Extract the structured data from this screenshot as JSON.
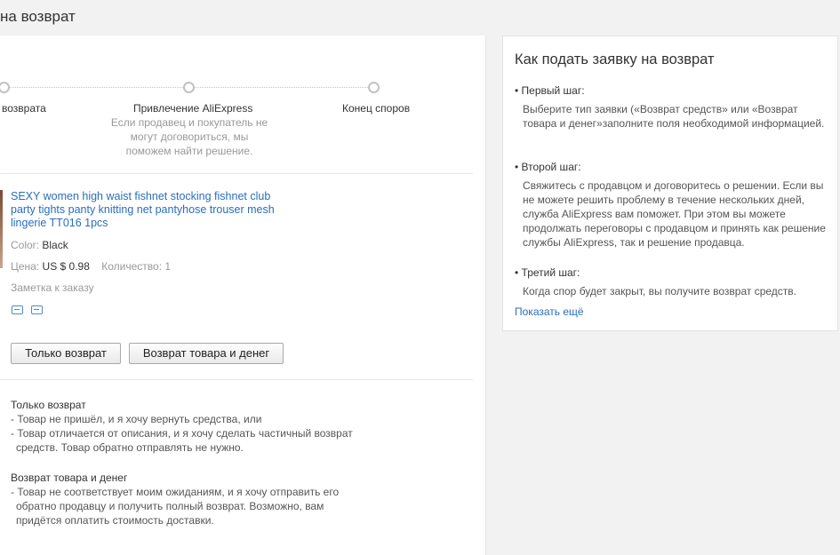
{
  "page": {
    "title": "на возврат"
  },
  "steps": [
    {
      "label": "возврата"
    },
    {
      "label": "Привлечение AliExpress",
      "desc": "Если продавец и покупатель не могут договориться, мы поможем найти решение."
    },
    {
      "label": "Конец споров"
    }
  ],
  "product": {
    "title": "SEXY women high waist fishnet stocking fishnet club party tights panty knitting net pantyhose trouser mesh lingerie TT016 1pcs",
    "color_label": "Color:",
    "color_value": "Black",
    "price_label": "Цена:",
    "price_value": "US $ 0.98",
    "qty_label": "Количество:",
    "qty_value": "1",
    "note": "Заметка к заказу"
  },
  "buttons": {
    "refund_only": "Только возврат",
    "return_refund": "Возврат товара и денег"
  },
  "info": {
    "refund_only": {
      "title": "Только возврат",
      "lines": [
        "- Товар не пришёл, и я хочу вернуть средства, или",
        "- Товар отличается от описания, и я хочу сделать частичный возврат",
        "средств. Товар обратно отправлять не нужно."
      ]
    },
    "return_refund": {
      "title": "Возврат товара и денег",
      "lines": [
        "- Товар не соответствует моим ожиданиям, и я хочу отправить его",
        "обратно продавцу и получить полный возврат. Возможно, вам",
        "придётся оплатить стоимость доставки."
      ]
    }
  },
  "side": {
    "title": "Как подать заявку на возврат",
    "steps": [
      {
        "label": "• Первый шаг:",
        "text": "Выберите тип заявки («Возврат средств» или «Возврат товара и денег»заполните поля необходимой информацией."
      },
      {
        "label": "• Второй шаг:",
        "text": "Свяжитесь с продавцом и договоритесь о решении. Если вы не можете решить проблему в течение нескольких дней, служба AliExpress вам поможет. При этом вы можете продолжать переговоры с продавцом и принять как решение службы AliExpress, так и решение продавца."
      },
      {
        "label": "• Третий шаг:",
        "text": "Когда спор будет закрыт, вы получите возврат средств."
      }
    ],
    "show_more": "Показать ещё"
  },
  "colors": {
    "link": "#2a6ebb",
    "muted": "#999999",
    "panel_bg": "#ffffff",
    "page_bg": "#f2f2f2"
  }
}
